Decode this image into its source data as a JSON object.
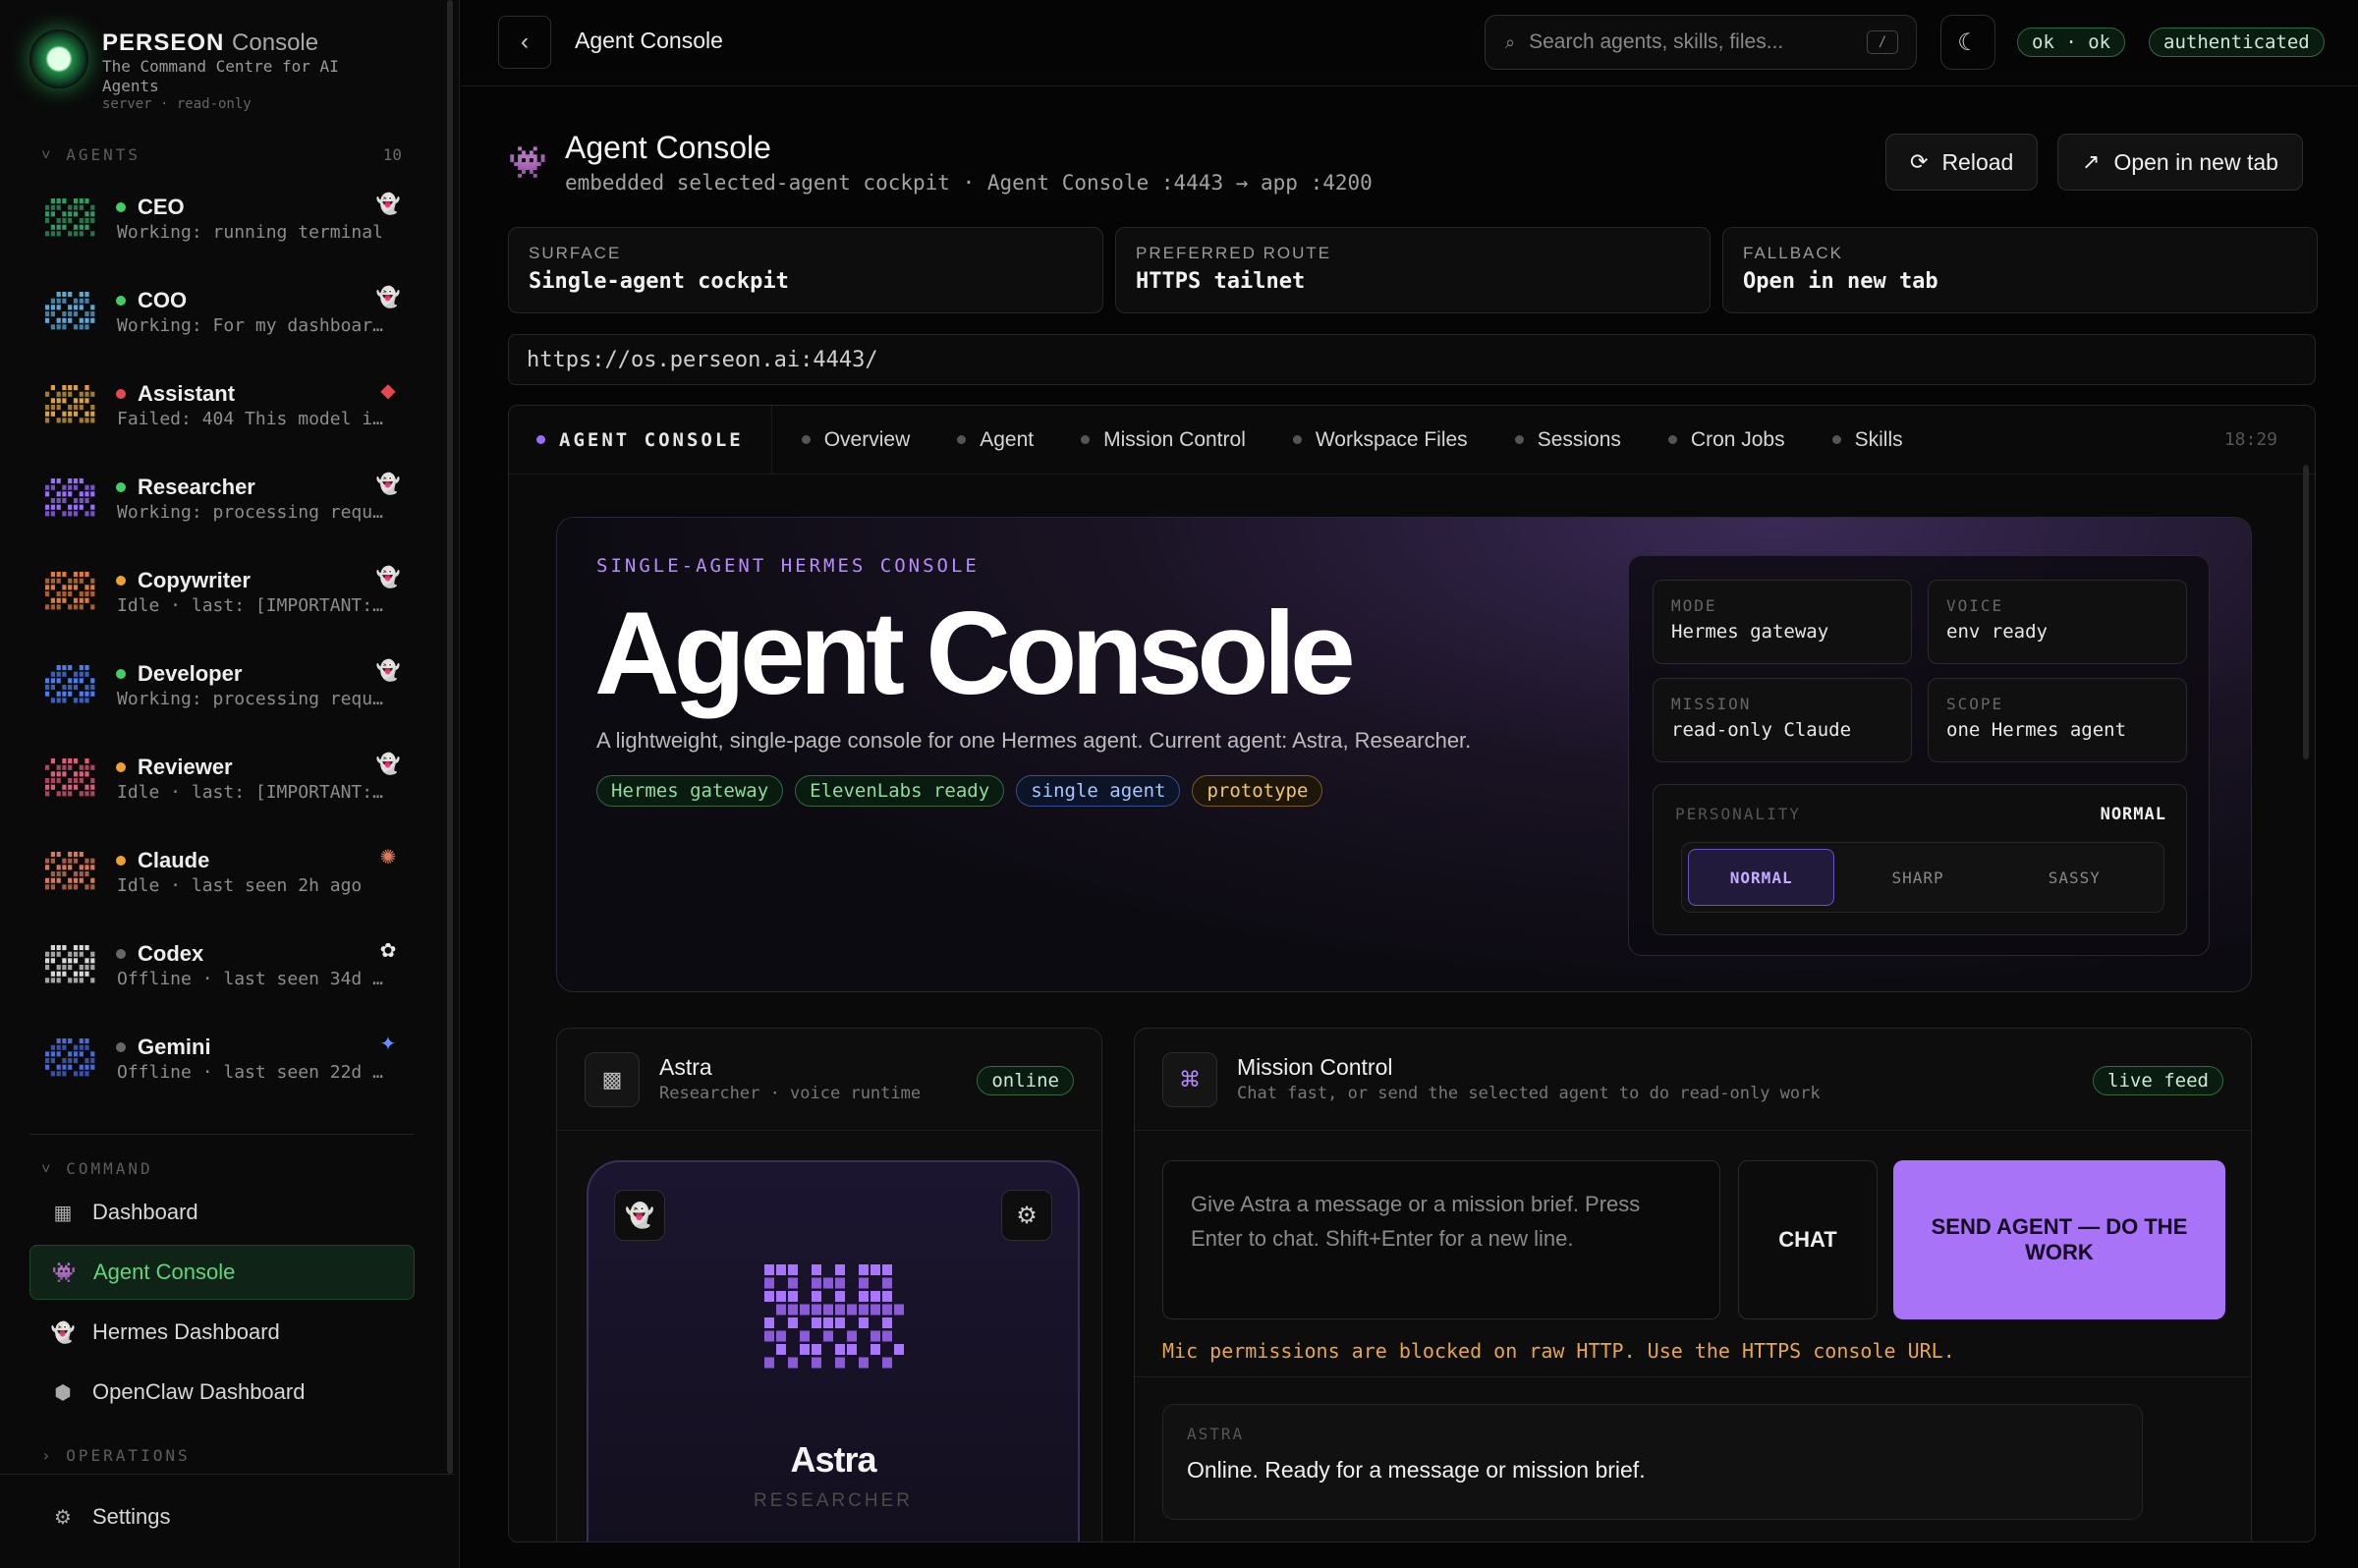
{
  "brand": {
    "name": "PERSEON",
    "suffix": "Console",
    "tagline": "The Command Centre for AI Agents",
    "server_mode": "server · read-only"
  },
  "sidebar": {
    "agents_label": "AGENTS",
    "agents_count": "10",
    "agents": [
      {
        "name": "CEO",
        "status": "Working: running terminal",
        "status_color": "#3fcf63",
        "accent": "#2e9a66",
        "badge": "ghost"
      },
      {
        "name": "COO",
        "status": "Working: For my dashboar…",
        "status_color": "#3fcf63",
        "accent": "#5aa8d8",
        "badge": "ghost"
      },
      {
        "name": "Assistant",
        "status": "Failed: 404 This model i…",
        "status_color": "#e5484d",
        "accent": "#d9a23a",
        "badge": "diamond"
      },
      {
        "name": "Researcher",
        "status": "Working: processing requ…",
        "status_color": "#3fcf63",
        "accent": "#9a6cff",
        "badge": "ghost"
      },
      {
        "name": "Copywriter",
        "status": "Idle · last: [IMPORTANT:…",
        "status_color": "#f0a030",
        "accent": "#e07a3a",
        "badge": "ghost"
      },
      {
        "name": "Developer",
        "status": "Working: processing requ…",
        "status_color": "#3fcf63",
        "accent": "#4a7cf0",
        "badge": "ghost"
      },
      {
        "name": "Reviewer",
        "status": "Idle · last: [IMPORTANT:…",
        "status_color": "#f0a030",
        "accent": "#e05a7a",
        "badge": "ghost"
      },
      {
        "name": "Claude",
        "status": "Idle · last seen 2h ago",
        "status_color": "#f0a030",
        "accent": "#d47a5a",
        "badge": "sunburst"
      },
      {
        "name": "Codex",
        "status": "Offline · last seen 34d …",
        "status_color": "#666666",
        "accent": "#d8d8d8",
        "badge": "openai"
      },
      {
        "name": "Gemini",
        "status": "Offline · last seen 22d …",
        "status_color": "#666666",
        "accent": "#4a6ad8",
        "badge": "sparkle"
      }
    ],
    "command_label": "COMMAND",
    "nav": [
      {
        "label": "Dashboard",
        "icon": "grid-icon",
        "active": false
      },
      {
        "label": "Agent Console",
        "icon": "invader-icon",
        "active": true
      },
      {
        "label": "Hermes Dashboard",
        "icon": "ghost-icon",
        "active": false
      },
      {
        "label": "OpenClaw Dashboard",
        "icon": "claw-icon",
        "active": false
      }
    ],
    "operations_label": "OPERATIONS",
    "settings_label": "Settings"
  },
  "topbar": {
    "title": "Agent Console",
    "search_placeholder": "Search agents, skills, files...",
    "search_shortcut": "/",
    "status_pill": "ok · ok",
    "auth_pill": "authenticated"
  },
  "page": {
    "title": "Agent Console",
    "subtitle": "embedded selected-agent cockpit · Agent Console :4443 → app :4200",
    "reload_label": "Reload",
    "open_tab_label": "Open in new tab",
    "info_cards": [
      {
        "label": "SURFACE",
        "value": "Single-agent cockpit"
      },
      {
        "label": "PREFERRED ROUTE",
        "value": "HTTPS tailnet"
      },
      {
        "label": "FALLBACK",
        "value": "Open in new tab"
      }
    ],
    "url": "https://os.perseon.ai:4443/"
  },
  "frame": {
    "brand_tab": "AGENT CONSOLE",
    "tabs": [
      "Overview",
      "Agent",
      "Mission Control",
      "Workspace Files",
      "Sessions",
      "Cron Jobs",
      "Skills"
    ],
    "time": "18:29"
  },
  "hero": {
    "kicker": "SINGLE-AGENT HERMES CONSOLE",
    "title": "Agent Console",
    "description": "A lightweight, single-page console for one Hermes agent. Current agent: Astra, Researcher.",
    "tags": [
      {
        "label": "Hermes gateway",
        "color": "#8fdca0",
        "border": "#2f6a3f",
        "bg": "#0a1c10"
      },
      {
        "label": "ElevenLabs ready",
        "color": "#8fdca0",
        "border": "#2f6a3f",
        "bg": "#0a1c10"
      },
      {
        "label": "single agent",
        "color": "#a9c6ff",
        "border": "#34508a",
        "bg": "#0c1428"
      },
      {
        "label": "prototype",
        "color": "#f2c66a",
        "border": "#7a5a1e",
        "bg": "#1e160a"
      }
    ],
    "mini": [
      {
        "label": "MODE",
        "value": "Hermes gateway"
      },
      {
        "label": "VOICE",
        "value": "env ready"
      },
      {
        "label": "MISSION",
        "value": "read-only Claude"
      },
      {
        "label": "SCOPE",
        "value": "one Hermes agent"
      }
    ],
    "personality_label": "PERSONALITY",
    "personality_value": "NORMAL",
    "personality_options": [
      "NORMAL",
      "SHARP",
      "SASSY"
    ]
  },
  "astra_card": {
    "title": "Astra",
    "subtitle": "Researcher · voice runtime",
    "status": "online",
    "name": "Astra",
    "role": "RESEARCHER"
  },
  "mission": {
    "title": "Mission Control",
    "subtitle": "Chat fast, or send the selected agent to do read-only work",
    "status": "live feed",
    "input_placeholder": "Give Astra a message or a mission brief. Press Enter to chat. Shift+Enter for a new line.",
    "chat_label": "CHAT",
    "send_label": "SEND AGENT — DO THE WORK",
    "warning": "Mic permissions are blocked on raw HTTP. Use the HTTPS console URL.",
    "log_label": "ASTRA",
    "log_text": "Online. Ready for a message or mission brief."
  }
}
